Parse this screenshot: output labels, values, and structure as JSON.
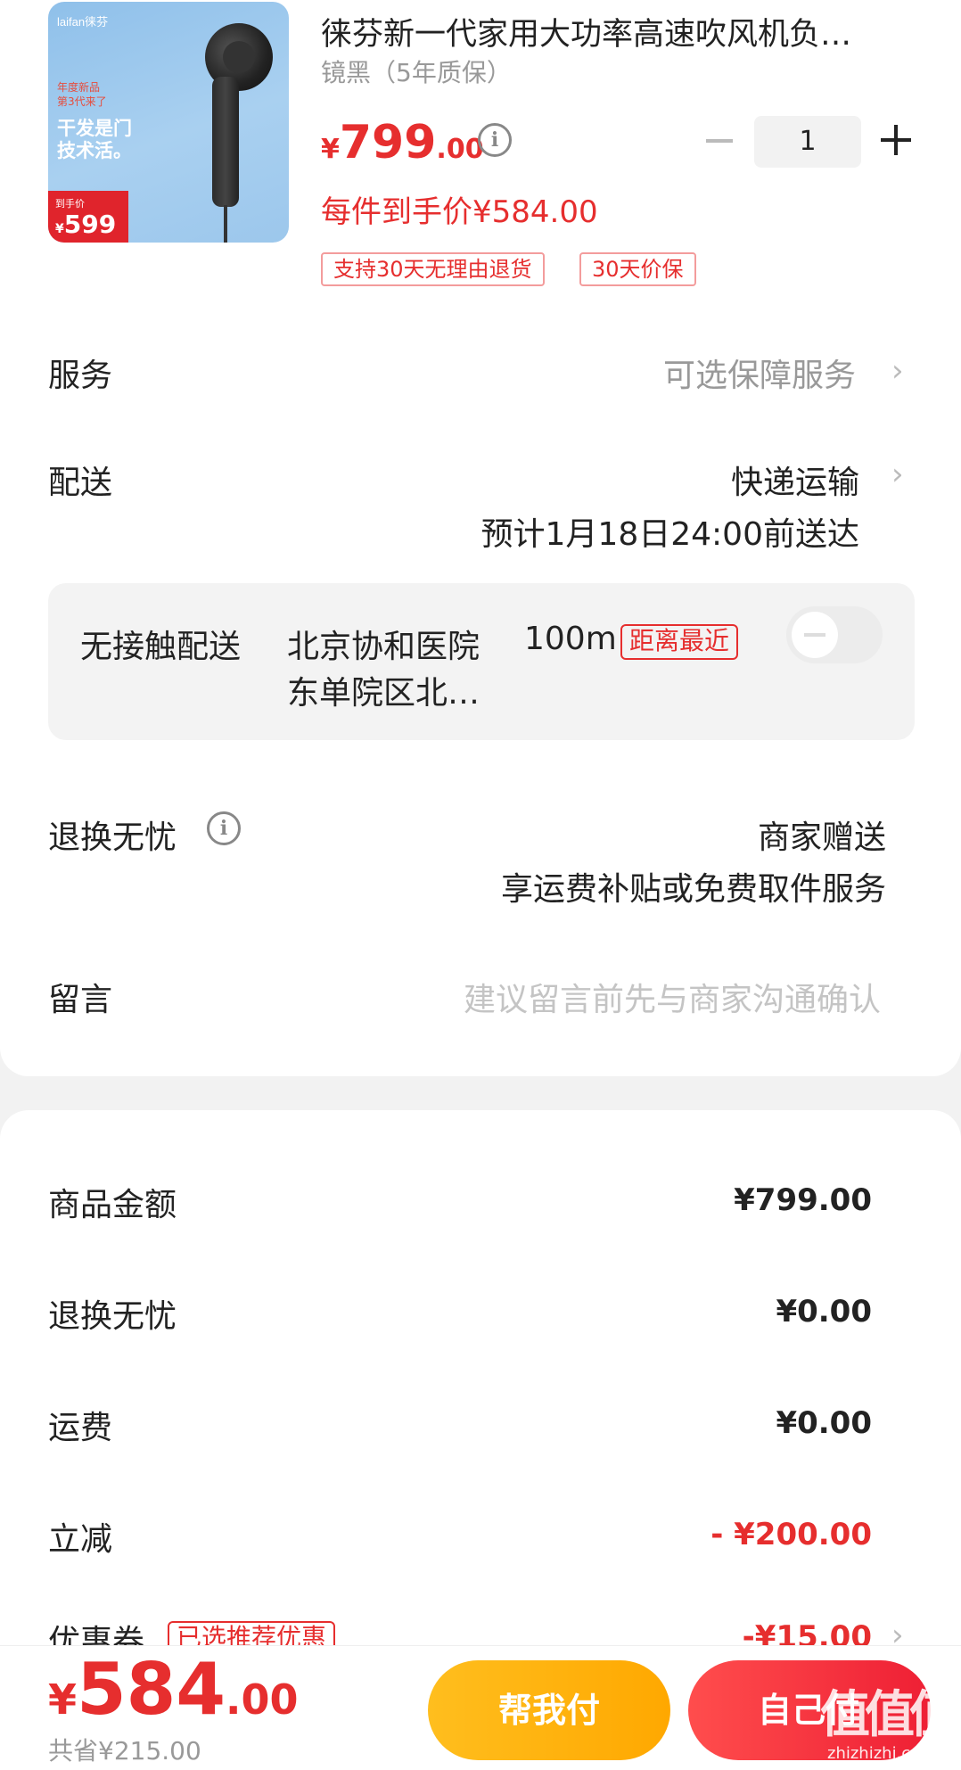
{
  "product": {
    "title": "徕芬新一代家用大功率高速吹风机负…",
    "spec": "镜黑（5年质保）",
    "price_symbol": "¥",
    "price_int": "799",
    "price_dec": ".00",
    "net_price": "每件到手价¥584.00",
    "tags": [
      "支持30天无理由退货",
      "30天价保"
    ],
    "quantity": "1",
    "image": {
      "brand": "laifan徕芬",
      "line1": "年度新品",
      "line2": "第3代来了",
      "slogan1": "干发是门",
      "slogan2": "技术活。",
      "price_label": "到手价",
      "price_symbol": "¥",
      "price": "599"
    }
  },
  "service": {
    "label": "服务",
    "value": "可选保障服务"
  },
  "delivery": {
    "label": "配送",
    "method": "快递运输",
    "eta": "预计1月18日24:00前送达"
  },
  "contactless": {
    "label": "无接触配送",
    "location_line1": "北京协和医院",
    "location_line2": "东单院区北…",
    "distance": "100m",
    "badge": "距离最近"
  },
  "return_worry_free": {
    "label": "退换无忧",
    "value": "商家赠送",
    "desc": "享运费补贴或免费取件服务"
  },
  "message": {
    "label": "留言",
    "placeholder": "建议留言前先与商家沟通确认"
  },
  "summary": {
    "rows": [
      {
        "label": "商品金额",
        "value": "¥799.00"
      },
      {
        "label": "退换无忧",
        "value": "¥0.00"
      },
      {
        "label": "运费",
        "value": "¥0.00"
      },
      {
        "label": "立减",
        "value": "- ¥200.00"
      }
    ],
    "coupon": {
      "label": "优惠券",
      "badge": "已选推荐优惠",
      "value": "-¥15.00"
    }
  },
  "footer": {
    "total_symbol": "¥",
    "total_int": "584",
    "total_dec": ".00",
    "saved": "共省¥215.00",
    "help_pay": "帮我付",
    "self_pay": "自己付",
    "watermark": "值值值",
    "watermark_url": "zhizhizhi.com"
  },
  "colors": {
    "accent_red": "#e62e2e",
    "help_btn": "#ffb300",
    "pay_btn": "#ee1f34"
  }
}
